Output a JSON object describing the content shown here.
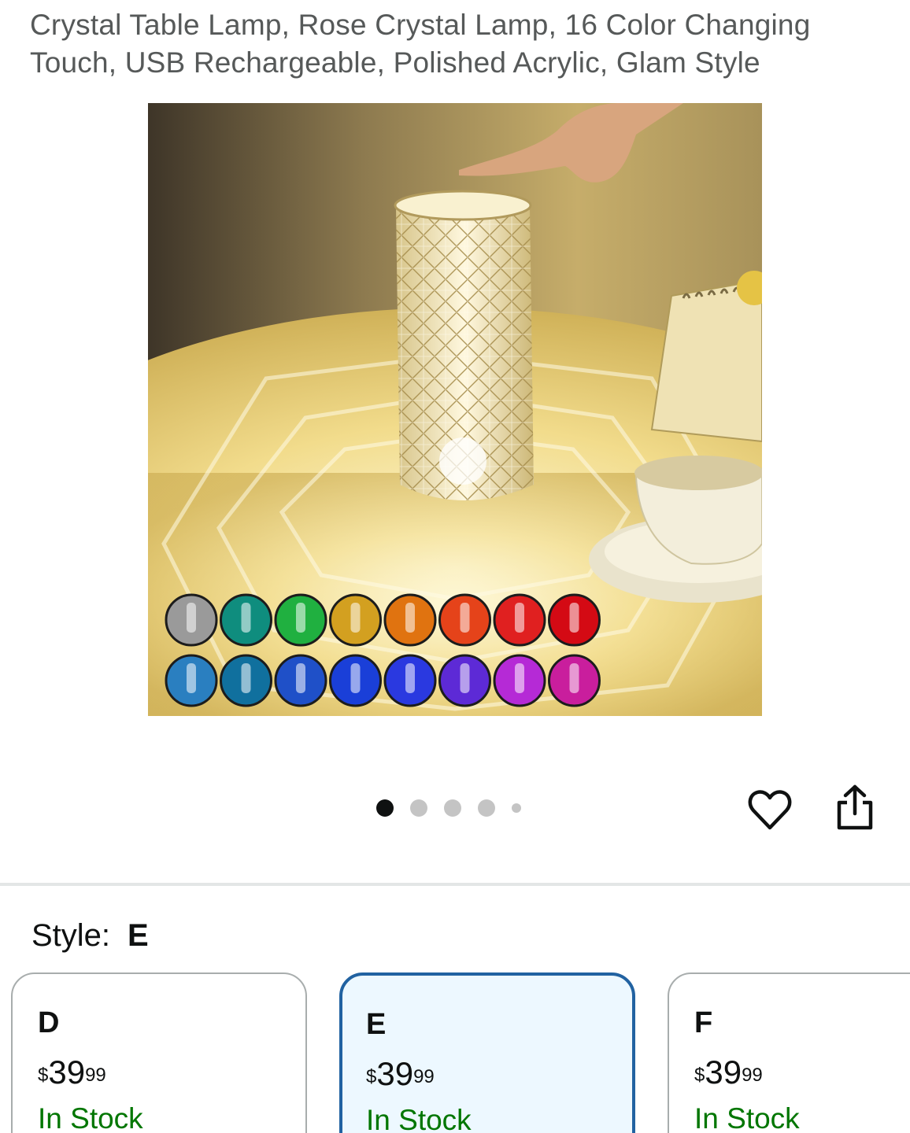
{
  "product": {
    "title": "Crystal Table Lamp, Rose Crystal Lamp, 16 Color Changing Touch, USB Rechargeable, Polished Acrylic, Glam Style"
  },
  "gallery": {
    "image_alt": "Crystal table lamp glowing warm yellow with 16 color options",
    "dot_count": 5,
    "active_index": 0,
    "swatch_colors": [
      "#9a9a9a",
      "#0f8d7e",
      "#20b040",
      "#d3a020",
      "#e07310",
      "#e5431a",
      "#e02020",
      "#d40a14",
      "#2a7fc0",
      "#10709e",
      "#1f50c8",
      "#1a3fd8",
      "#2a39e0",
      "#5d2ad6",
      "#b52ad6",
      "#c91e9d"
    ]
  },
  "actions": {
    "wishlist_icon": "heart-icon",
    "share_icon": "share-icon"
  },
  "style": {
    "label": "Style:",
    "selected": "E"
  },
  "options": [
    {
      "name": "D",
      "currency": "$",
      "whole": "39",
      "fraction": "99",
      "stock": "In Stock"
    },
    {
      "name": "E",
      "currency": "$",
      "whole": "39",
      "fraction": "99",
      "stock": "In Stock"
    },
    {
      "name": "F",
      "currency": "$",
      "whole": "39",
      "fraction": "99",
      "stock": "In Stock"
    }
  ],
  "colors": {
    "accent": "#2162a1",
    "in_stock": "#007600",
    "title_gray": "#565959"
  }
}
